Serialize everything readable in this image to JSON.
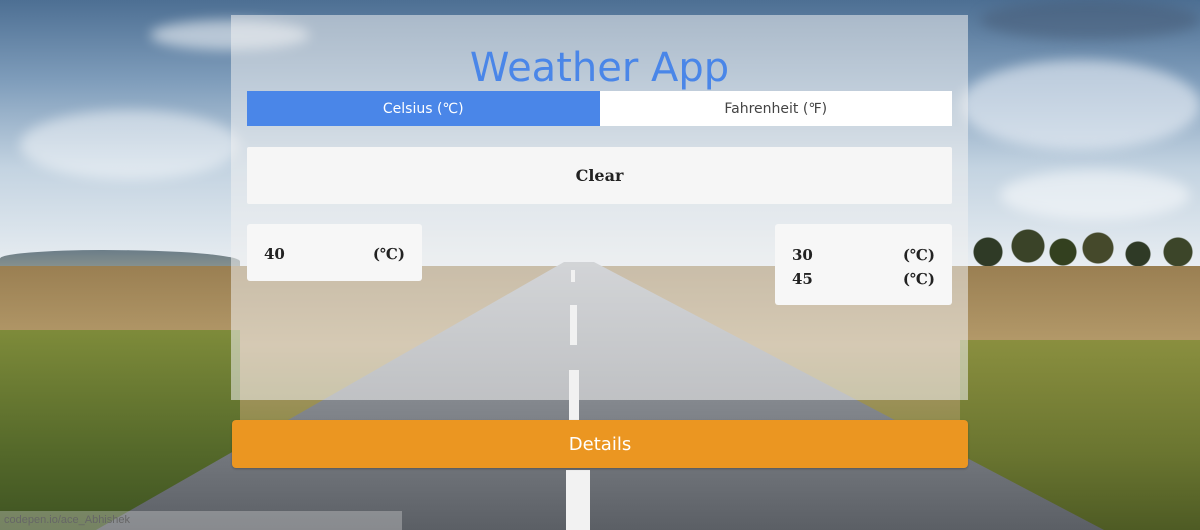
{
  "app": {
    "title": "Weather App"
  },
  "units": {
    "celsius_label": "Celsius (℃)",
    "fahrenheit_label": "Fahrenheit (℉)",
    "selected": "celsius"
  },
  "actions": {
    "clear_label": "Clear",
    "details_label": "Details"
  },
  "input_card": {
    "value": "40",
    "unit": "(℃)"
  },
  "result_card": {
    "rows": [
      {
        "value": "30",
        "unit": "(℃)"
      },
      {
        "value": "45",
        "unit": "(℃)"
      }
    ]
  },
  "status_bar": {
    "text": "codepen.io/ace_Abhishek"
  },
  "colors": {
    "accent_blue": "#4a86e8",
    "details_orange": "#eb9621"
  }
}
